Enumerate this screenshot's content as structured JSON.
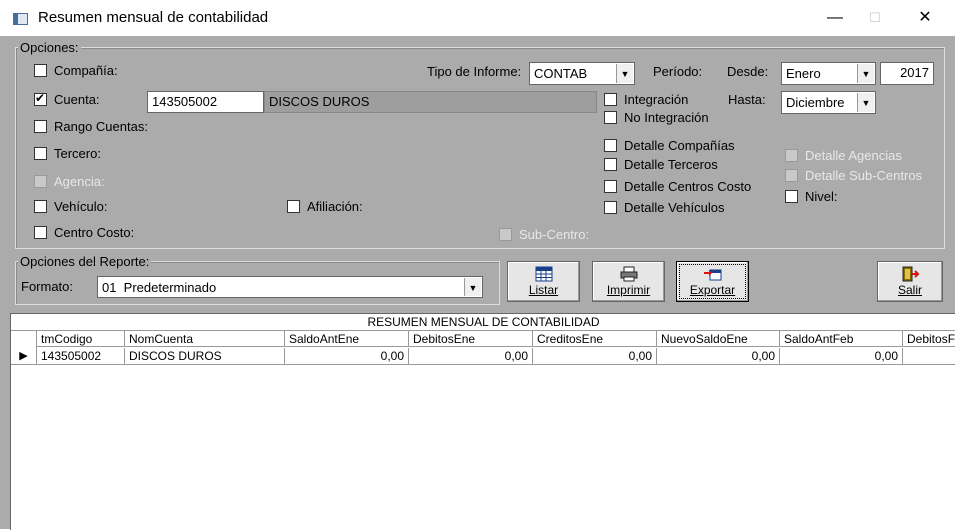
{
  "window": {
    "title": "Resumen mensual de contabilidad",
    "min_glyph": "—",
    "max_glyph": "☐",
    "close_glyph": "✕"
  },
  "opciones": {
    "group_title": "Opciones:",
    "compania": {
      "label": "Compañía:",
      "checked": false
    },
    "cuenta": {
      "label": "Cuenta:",
      "checked": true,
      "code": "143505002",
      "name": "DISCOS DUROS"
    },
    "rango_cuentas": {
      "label": "Rango Cuentas:"
    },
    "tercero": {
      "label": "Tercero:"
    },
    "agencia": {
      "label": "Agencia:"
    },
    "vehiculo": {
      "label": "Vehículo:"
    },
    "afiliacion": {
      "label": "Afiliación:"
    },
    "centro_costo": {
      "label": "Centro Costo:"
    },
    "sub_centro": {
      "label": "Sub-Centro:"
    },
    "tipo_informe": {
      "label": "Tipo de Informe:",
      "value": "CONTAB"
    },
    "periodo": {
      "label": "Período:",
      "desde_label": "Desde:",
      "desde_value": "Enero",
      "year": "2017",
      "hasta_label": "Hasta:",
      "hasta_value": "Diciembre"
    },
    "integracion": "Integración",
    "no_integracion": "No Integración",
    "detalle_companias": "Detalle Compañías",
    "detalle_terceros": "Detalle Terceros",
    "detalle_centros_costo": "Detalle Centros Costo",
    "detalle_vehiculos": "Detalle Vehículos",
    "detalle_agencias": "Detalle Agencias",
    "detalle_subcentros": "Detalle Sub-Centros",
    "nivel": "Nivel:"
  },
  "reporte": {
    "group_title": "Opciones del Reporte:",
    "formato_label": "Formato:",
    "formato_value": "01  Predeterminado"
  },
  "buttons": {
    "listar": "Listar",
    "imprimir": "Imprimir",
    "exportar": "Exportar",
    "salir": "Salir"
  },
  "grid": {
    "caption": "RESUMEN MENSUAL DE CONTABILIDAD",
    "columns": [
      "tmCodigo",
      "NomCuenta",
      "SaldoAntEne",
      "DebitosEne",
      "CreditosEne",
      "NuevoSaldoEne",
      "SaldoAntFeb",
      "DebitosF"
    ],
    "rows": [
      [
        "143505002",
        "DISCOS DUROS",
        "0,00",
        "0,00",
        "0,00",
        "0,00",
        "0,00",
        ""
      ]
    ],
    "row_marker": "▶"
  },
  "colors": {
    "form_bg": "#ababab",
    "grid_bg": "#ffffff"
  }
}
